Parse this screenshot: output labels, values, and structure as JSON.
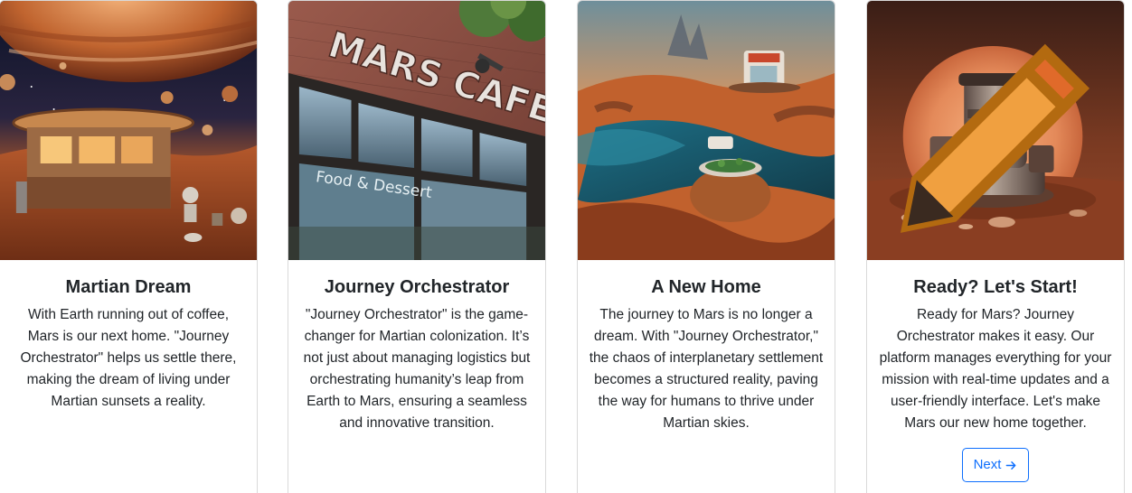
{
  "cards": [
    {
      "image_alt": "Martian coffee kiosk under a giant planet",
      "title": "Martian Dream",
      "text": "With Earth running out of coffee, Mars is our next home. \"Journey Orchestrator\" helps us settle there, making the dream of living under Martian sunsets a reality."
    },
    {
      "image_alt": "Mars Cafe storefront",
      "title": "Journey Orchestrator",
      "text": "\"Journey Orchestrator\" is the game-changer for Martian colonization. It’s not just about managing logistics but orchestrating humanity’s leap from Earth to Mars, ensuring a seamless and innovative transition.",
      "sign_text": "MARS CAFE",
      "window_text": "Food & Dessert"
    },
    {
      "image_alt": "Coffee cup settlement on Martian landscape",
      "title": "A New Home",
      "text": "The journey to Mars is no longer a dream. With \"Journey Orchestrator,\" the chaos of interplanetary settlement becomes a structured reality, paving the way for humans to thrive under Martian skies."
    },
    {
      "image_alt": "Coffee machine on Mars at sunset",
      "title": "Ready? Let's Start!",
      "text": "Ready for Mars? Journey Orchestrator makes it easy. Our platform manages everything for your mission with real-time updates and a user-friendly interface. Let's make Mars our new home together.",
      "button_label": "Next",
      "button_icon": "arrow-right-icon"
    }
  ],
  "colors": {
    "accent": "#0d6efd",
    "text": "#212529",
    "border": "#d9d9d9"
  }
}
